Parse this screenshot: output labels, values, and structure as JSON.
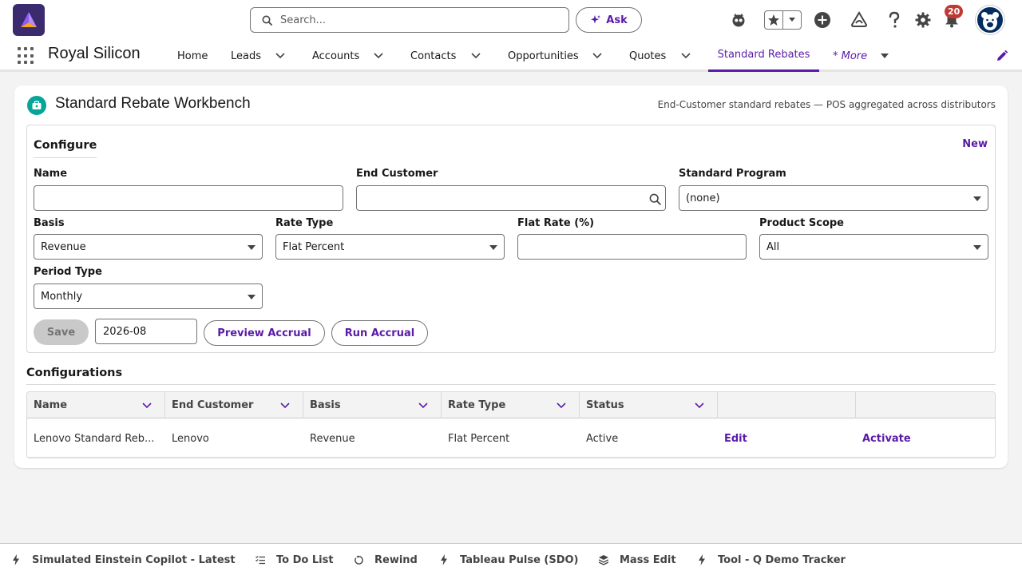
{
  "header": {
    "search_placeholder": "Search...",
    "ask_label": "Ask",
    "notification_count": "20"
  },
  "nav": {
    "app_name": "Royal Silicon",
    "items": [
      {
        "label": "Home"
      },
      {
        "label": "Leads"
      },
      {
        "label": "Accounts"
      },
      {
        "label": "Contacts"
      },
      {
        "label": "Opportunities"
      },
      {
        "label": "Quotes"
      }
    ],
    "active_item": "Standard Rebates",
    "more_label": "* More"
  },
  "page": {
    "title": "Standard Rebate Workbench",
    "subtitle": "End-Customer standard rebates — POS aggregated across distributors"
  },
  "configure": {
    "heading": "Configure",
    "new_label": "New",
    "fields": {
      "name": {
        "label": "Name",
        "value": ""
      },
      "end_customer": {
        "label": "End Customer",
        "value": ""
      },
      "standard_program": {
        "label": "Standard Program",
        "value": "(none)"
      },
      "basis": {
        "label": "Basis",
        "value": "Revenue"
      },
      "rate_type": {
        "label": "Rate Type",
        "value": "Flat Percent"
      },
      "flat_rate": {
        "label": "Flat Rate (%)",
        "value": ""
      },
      "product_scope": {
        "label": "Product Scope",
        "value": "All"
      },
      "period_type": {
        "label": "Period Type",
        "value": "Monthly"
      }
    },
    "save_label": "Save",
    "period_value": "2026-08",
    "preview_label": "Preview Accrual",
    "run_label": "Run Accrual"
  },
  "configurations": {
    "heading": "Configurations",
    "columns": [
      "Name",
      "End Customer",
      "Basis",
      "Rate Type",
      "Status"
    ],
    "rows": [
      {
        "name": "Lenovo Standard Reb...",
        "end_customer": "Lenovo",
        "basis": "Revenue",
        "rate_type": "Flat Percent",
        "status": "Active",
        "edit_label": "Edit",
        "activate_label": "Activate"
      }
    ]
  },
  "utility_bar": {
    "items": [
      {
        "label": "Simulated Einstein Copilot - Latest",
        "icon": "bolt-icon"
      },
      {
        "label": "To Do List",
        "icon": "checklist-icon"
      },
      {
        "label": "Rewind",
        "icon": "rewind-icon"
      },
      {
        "label": "Tableau Pulse (SDO)",
        "icon": "bolt-icon"
      },
      {
        "label": "Mass Edit",
        "icon": "layers-icon"
      },
      {
        "label": "Tool - Q Demo Tracker",
        "icon": "bolt-icon"
      }
    ]
  },
  "colors": {
    "brand": "#5a1ba9",
    "logo_bg": "#3b2a6e",
    "card_icon": "#06a59a",
    "badge": "#c23934"
  }
}
